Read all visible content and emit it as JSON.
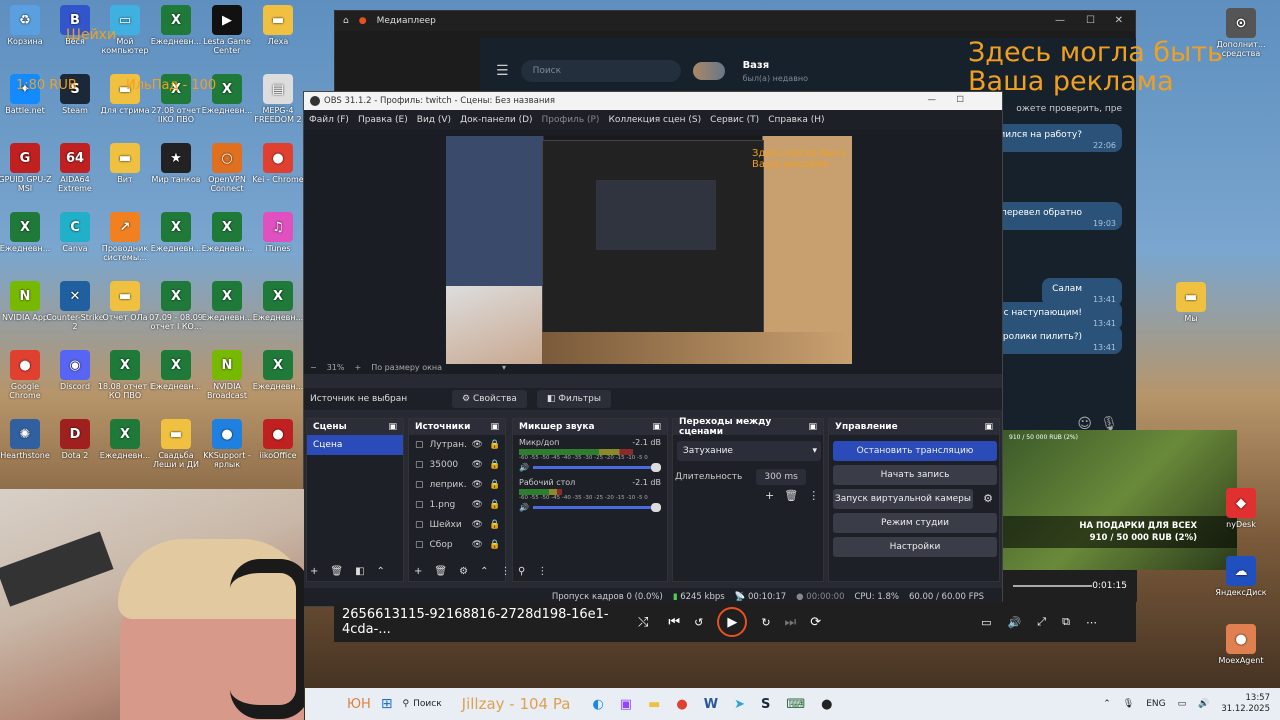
{
  "desktop_icons": [
    {
      "label": "Корзина",
      "color": "#5aa0e0",
      "glyph": "♻"
    },
    {
      "label": "Веся",
      "color": "#3355cc",
      "glyph": "B"
    },
    {
      "label": "Мой компьютер",
      "color": "#40b0e0",
      "glyph": "▭"
    },
    {
      "label": "Ежедневн...",
      "color": "#1f7a3a",
      "glyph": "X"
    },
    {
      "label": "Lesta Game Center",
      "color": "#111",
      "glyph": "▶"
    },
    {
      "label": "Леха",
      "color": "#f0c040",
      "glyph": "▬"
    },
    {
      "label": "Battle.net",
      "color": "#148aff",
      "glyph": "✦"
    },
    {
      "label": "Steam",
      "color": "#1b2838",
      "glyph": "S"
    },
    {
      "label": "Для стрима",
      "color": "#f0c040",
      "glyph": "▬"
    },
    {
      "label": "27.08 отчет IIKO ПВО",
      "color": "#1f7a3a",
      "glyph": "X"
    },
    {
      "label": "Ежедневн...",
      "color": "#1f7a3a",
      "glyph": "X"
    },
    {
      "label": "MEPG-4 FREEDOM 2",
      "color": "#ddd",
      "glyph": "▤"
    },
    {
      "label": "GPUID GPU-Z MSI",
      "color": "#c02020",
      "glyph": "G"
    },
    {
      "label": "AIDA64 Extreme",
      "color": "#c02020",
      "glyph": "64"
    },
    {
      "label": "Вит",
      "color": "#f0c040",
      "glyph": "▬"
    },
    {
      "label": "Мир танков",
      "color": "#222",
      "glyph": "★"
    },
    {
      "label": "OpenVPN Connect",
      "color": "#e07020",
      "glyph": "○"
    },
    {
      "label": "Kei - Chrome",
      "color": "#e04030",
      "glyph": "●"
    },
    {
      "label": "Ежедневн...",
      "color": "#1f7a3a",
      "glyph": "X"
    },
    {
      "label": "Canva",
      "color": "#20b0c8",
      "glyph": "C"
    },
    {
      "label": "Проводник системы...",
      "color": "#f08020",
      "glyph": "↗"
    },
    {
      "label": "Ежедневн...",
      "color": "#1f7a3a",
      "glyph": "X"
    },
    {
      "label": "Ежедневн...",
      "color": "#1f7a3a",
      "glyph": "X"
    },
    {
      "label": "iTunes",
      "color": "#e050c0",
      "glyph": "♫"
    },
    {
      "label": "NVIDIA App",
      "color": "#76b900",
      "glyph": "N"
    },
    {
      "label": "Counter-Strike 2",
      "color": "#2060a0",
      "glyph": "✕"
    },
    {
      "label": "Отчет ОЛа",
      "color": "#f0c040",
      "glyph": "▬"
    },
    {
      "label": "07.09 - 08.09 отчет I КО...",
      "color": "#1f7a3a",
      "glyph": "X"
    },
    {
      "label": "Ежедневн...",
      "color": "#1f7a3a",
      "glyph": "X"
    },
    {
      "label": "Ежедневн...",
      "color": "#1f7a3a",
      "glyph": "X"
    },
    {
      "label": "Google Chrome",
      "color": "#e04030",
      "glyph": "●"
    },
    {
      "label": "Discord",
      "color": "#5865f2",
      "glyph": "◉"
    },
    {
      "label": "18.08 отчет I КО ПВО",
      "color": "#1f7a3a",
      "glyph": "X"
    },
    {
      "label": "Ежедневн...",
      "color": "#1f7a3a",
      "glyph": "X"
    },
    {
      "label": "NVIDIA Broadcast",
      "color": "#76b900",
      "glyph": "N"
    },
    {
      "label": "Ежедневн...",
      "color": "#1f7a3a",
      "glyph": "X"
    },
    {
      "label": "Hearthstone",
      "color": "#3060a0",
      "glyph": "✺"
    },
    {
      "label": "Dota 2",
      "color": "#a02020",
      "glyph": "D"
    },
    {
      "label": "Ежедневн...",
      "color": "#1f7a3a",
      "glyph": "X"
    },
    {
      "label": "Свадьба Леши и ДИ",
      "color": "#f0c040",
      "glyph": "▬"
    },
    {
      "label": "KKSupport - ярлык",
      "color": "#2080e0",
      "glyph": "●"
    },
    {
      "label": "iikoOffice",
      "color": "#c02020",
      "glyph": "●"
    }
  ],
  "right_icons": [
    {
      "label": "Дополнит... средства",
      "color": "#555",
      "glyph": "⊙"
    },
    {
      "label": "Мы",
      "color": "#f0c040",
      "glyph": "▬"
    },
    {
      "label": "nyDesk",
      "color": "#e03030",
      "glyph": "◆"
    },
    {
      "label": "ЯндексДиск",
      "color": "#2050c0",
      "glyph": "☁"
    },
    {
      "label": "MoexAgent",
      "color": "#e08050",
      "glyph": "●"
    }
  ],
  "overlay": {
    "top_left_1": "Шейхи",
    "top_left_2": "1:80 RUB",
    "top_left_3": "ИльПад - 100",
    "ad": "Здесь могла быть Ваша реклама"
  },
  "media_player": {
    "title": "Медиаплеер",
    "filename": "2656613115-92168816-2728d198-16e1-4cda-...",
    "time": "0:01:15"
  },
  "telegram": {
    "search_placeholder": "Поиск",
    "contact_name": "Вазя",
    "contact_status": "был(а) недавно",
    "notice": "ожете проверить, пре",
    "messages": [
      {
        "text": "риился на работу?",
        "time": "22:06"
      },
      {
        "text": "большое перевел обратно",
        "time": "19:03"
      },
      {
        "text": "Салам",
        "time": "13:41"
      },
      {
        "text": "с наступающим!",
        "time": "13:41"
      },
      {
        "text": "ролики пилить?)",
        "time": "13:41"
      }
    ]
  },
  "obs": {
    "title": "OBS 31.1.2 - Профиль: twitch - Сцены: Без названия",
    "menu": [
      "Файл (F)",
      "Правка (E)",
      "Вид (V)",
      "Док-панели (D)",
      "Профиль (P)",
      "Коллекция сцен (S)",
      "Сервис (T)",
      "Справка (H)"
    ],
    "zoom": "31%",
    "fit": "По размеру окна",
    "no_source": "Источник не выбран",
    "properties": "Свойства",
    "filters": "Фильтры",
    "scenes_title": "Сцены",
    "scenes": [
      "Сцена"
    ],
    "sources_title": "Источники",
    "sources": [
      "Лутран.",
      "35000",
      "леприк.",
      "1.png",
      "Шейхи",
      "Сбор"
    ],
    "mixer_title": "Микшер звука",
    "mixer": [
      {
        "name": "Микр/доп",
        "db": "-2.1 dB",
        "level": 0.8
      },
      {
        "name": "Рабочий стол",
        "db": "-2.1 dB",
        "level": 0.3
      }
    ],
    "meter_scale": "-60 -55 -50 -45 -40 -35 -30 -25 -20 -15 -10 -5 0",
    "transitions_title": "Переходы между сценами",
    "transition": "Затухание",
    "duration_label": "Длительность",
    "duration": "300 ms",
    "controls_title": "Управление",
    "controls": [
      "Остановить трансляцию",
      "Начать запись",
      "Запуск виртуальной камеры",
      "Режим студии",
      "Настройки"
    ],
    "status": {
      "dropped": "Пропуск кадров 0 (0.0%)",
      "bitrate": "6245 kbps",
      "stream_time": "00:10:17",
      "rec_time": "00:00:00",
      "cpu": "CPU: 1.8%",
      "fps": "60.00 / 60.00 FPS"
    }
  },
  "preview_overlay": "Здесь могла быть Ваша реклама",
  "donation": {
    "line1": "НА ПОДАРКИ ДЛЯ ВСЕХ",
    "line2": "910 / 50 000 RUB (2%)",
    "top_line": "910 / 50 000 RUB (2%)"
  },
  "taskbar": {
    "search": "Поиск",
    "scroller": "Jillzay - 104 Pa",
    "lang": "ENG",
    "time": "13:57",
    "date": "31.12.2025",
    "left_text": "ЮН"
  }
}
